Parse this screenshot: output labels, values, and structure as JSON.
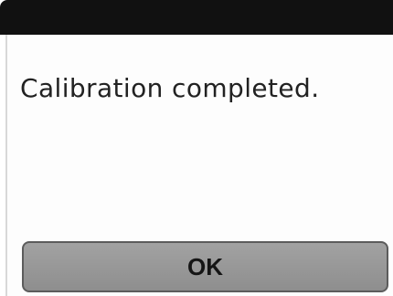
{
  "dialog": {
    "message": "Calibration completed.",
    "ok_label": "OK"
  },
  "colors": {
    "top_bar": "#111111",
    "background": "#ffffff",
    "button": "#999999",
    "button_border": "#5c5c5c"
  }
}
